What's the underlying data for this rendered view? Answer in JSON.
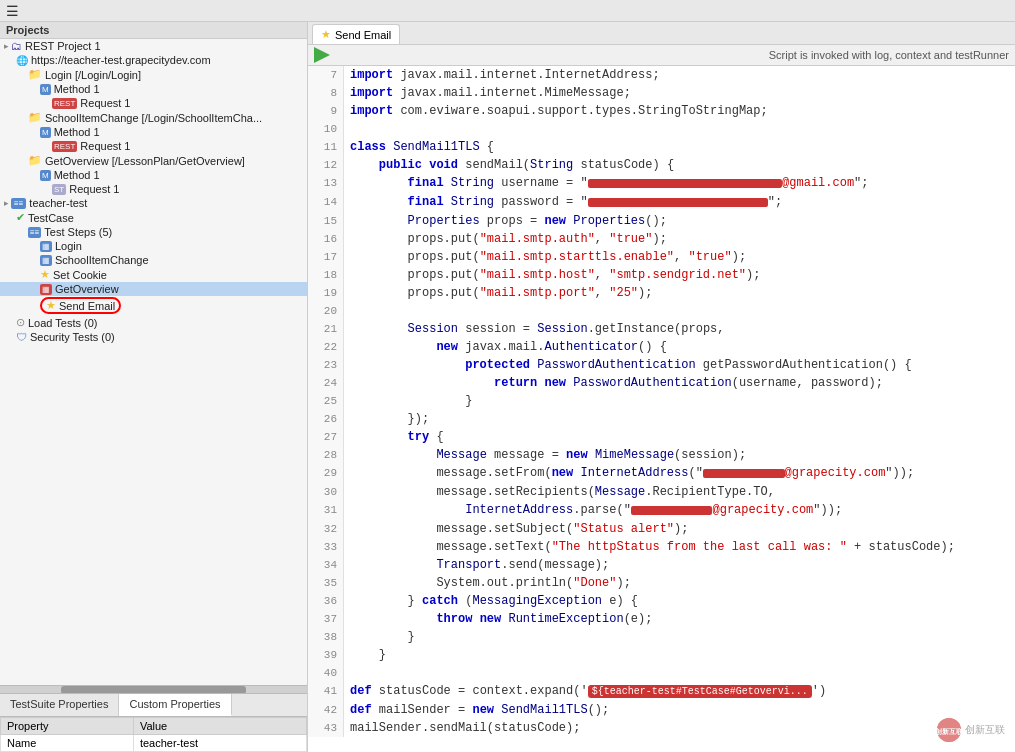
{
  "toolbar": {
    "hamburger": "☰"
  },
  "left": {
    "projects_label": "Projects",
    "tree": [
      {
        "indent": 0,
        "icon": "▸",
        "iconType": "folder",
        "label": "REST Project 1",
        "level": 0
      },
      {
        "indent": 12,
        "icon": "🌐",
        "iconType": "url",
        "label": "https://teacher-test.grapecitydev.com",
        "level": 1
      },
      {
        "indent": 24,
        "icon": "📁",
        "iconType": "folder",
        "label": "Login [/Login/Login]",
        "level": 2
      },
      {
        "indent": 36,
        "icon": "▦",
        "iconType": "method",
        "label": "Method 1",
        "level": 3
      },
      {
        "indent": 48,
        "icon": "REST",
        "iconType": "rest",
        "label": "Request 1",
        "level": 4
      },
      {
        "indent": 24,
        "icon": "📁",
        "iconType": "folder",
        "label": "SchoolItemChange [/Login/SchoolItemCha...",
        "level": 2
      },
      {
        "indent": 36,
        "icon": "▦",
        "iconType": "method",
        "label": "Method 1",
        "level": 3
      },
      {
        "indent": 48,
        "icon": "REST",
        "iconType": "rest",
        "label": "Request 1",
        "level": 4
      },
      {
        "indent": 24,
        "icon": "📁",
        "iconType": "folder",
        "label": "GetOverview [/LessonPlan/GetOverview]",
        "level": 2
      },
      {
        "indent": 36,
        "icon": "▦",
        "iconType": "method",
        "label": "Method 1",
        "level": 3
      },
      {
        "indent": 48,
        "icon": "ST",
        "iconType": "st",
        "label": "Request 1",
        "level": 4
      },
      {
        "indent": 0,
        "icon": "▸",
        "iconType": "testsuite",
        "label": "teacher-test",
        "level": 0,
        "special": "testsuite"
      },
      {
        "indent": 12,
        "icon": "✔",
        "iconType": "testcase",
        "label": "TestCase",
        "level": 1
      },
      {
        "indent": 24,
        "icon": "≡≡",
        "iconType": "teststeps",
        "label": "Test Steps (5)",
        "level": 2
      },
      {
        "indent": 36,
        "icon": "▦",
        "iconType": "login-step",
        "label": "Login",
        "level": 3
      },
      {
        "indent": 36,
        "icon": "▦",
        "iconType": "school-step",
        "label": "SchoolItemChange",
        "level": 3
      },
      {
        "indent": 36,
        "icon": "★",
        "iconType": "star",
        "label": "Set Cookie",
        "level": 3
      },
      {
        "indent": 36,
        "icon": "▦",
        "iconType": "get-step",
        "label": "GetOverview",
        "level": 3,
        "selected": true
      },
      {
        "indent": 36,
        "icon": "★",
        "iconType": "star-selected",
        "label": "Send Email",
        "level": 3,
        "circled": true
      },
      {
        "indent": 12,
        "icon": "⊙",
        "iconType": "load",
        "label": "Load Tests (0)",
        "level": 1
      },
      {
        "indent": 12,
        "icon": "🛡",
        "iconType": "security",
        "label": "Security Tests (0)",
        "level": 1
      }
    ]
  },
  "bottom_tabs": {
    "tabs": [
      "TestSuite Properties",
      "Custom Properties"
    ],
    "active": 1
  },
  "properties_table": {
    "headers": [
      "Property",
      "Value"
    ],
    "rows": [
      {
        "property": "Name",
        "value": "teacher-test"
      }
    ]
  },
  "right": {
    "tab_label": "Send Email",
    "play_label": "▶",
    "script_info": "Script is invoked with log, context and testRunner",
    "lines": [
      {
        "num": 7,
        "content": "import javax.mail.internet.InternetAddress;"
      },
      {
        "num": 8,
        "content": "import javax.mail.internet.MimeMessage;"
      },
      {
        "num": 9,
        "content": "import com.eviware.soapui.support.types.StringToStringMap;"
      },
      {
        "num": 10,
        "content": ""
      },
      {
        "num": 11,
        "content": "class SendMail1TLS {"
      },
      {
        "num": 12,
        "content": "    public void sendMail(String statusCode) {"
      },
      {
        "num": 13,
        "content": "        final String username = \"████████████@gmail.com\";"
      },
      {
        "num": 14,
        "content": "        final String password = \"████████████\";"
      },
      {
        "num": 15,
        "content": "        Properties props = new Properties();"
      },
      {
        "num": 16,
        "content": "        props.put(\"mail.smtp.auth\", \"true\");"
      },
      {
        "num": 17,
        "content": "        props.put(\"mail.smtp.starttls.enable\", \"true\");"
      },
      {
        "num": 18,
        "content": "        props.put(\"mail.smtp.host\", \"smtp.sendgrid.net\");"
      },
      {
        "num": 19,
        "content": "        props.put(\"mail.smtp.port\", \"25\");"
      },
      {
        "num": 20,
        "content": ""
      },
      {
        "num": 21,
        "content": "        Session session = Session.getInstance(props,"
      },
      {
        "num": 22,
        "content": "            new javax.mail.Authenticator() {"
      },
      {
        "num": 23,
        "content": "                protected PasswordAuthentication getPasswordAuthentication() {"
      },
      {
        "num": 24,
        "content": "                    return new PasswordAuthentication(username, password);"
      },
      {
        "num": 25,
        "content": "                }"
      },
      {
        "num": 26,
        "content": "        });"
      },
      {
        "num": 27,
        "content": "        try {"
      },
      {
        "num": 28,
        "content": "            Message message = new MimeMessage(session);"
      },
      {
        "num": 29,
        "content": "            message.setFrom(new InternetAddress(\"██████████@grapecity.com\"));"
      },
      {
        "num": 30,
        "content": "            message.setRecipients(Message.RecipientType.TO,"
      },
      {
        "num": 31,
        "content": "                InternetAddress.parse(\"██████████@grapecity.com\"));"
      },
      {
        "num": 32,
        "content": "            message.setSubject(\"Status alert\");"
      },
      {
        "num": 33,
        "content": "            message.setText(\"The httpStatus from the last call was: \" + statusCode);"
      },
      {
        "num": 34,
        "content": "            Transport.send(message);"
      },
      {
        "num": 35,
        "content": "            System.out.println(\"Done\");"
      },
      {
        "num": 36,
        "content": "        } catch (MessagingException e) {"
      },
      {
        "num": 37,
        "content": "            throw new RuntimeException(e);"
      },
      {
        "num": 38,
        "content": "        }"
      },
      {
        "num": 39,
        "content": "    }"
      },
      {
        "num": 40,
        "content": ""
      },
      {
        "num": 41,
        "content": "def statusCode = context.expand('${teacher-test#TestCase#Getovervi...')"
      },
      {
        "num": 42,
        "content": "def mailSender = new SendMail1TLS();"
      },
      {
        "num": 43,
        "content": "mailSender.sendMail(statusCode);"
      }
    ]
  },
  "watermark": {
    "logo": "创新互联",
    "text": "创新互联"
  }
}
